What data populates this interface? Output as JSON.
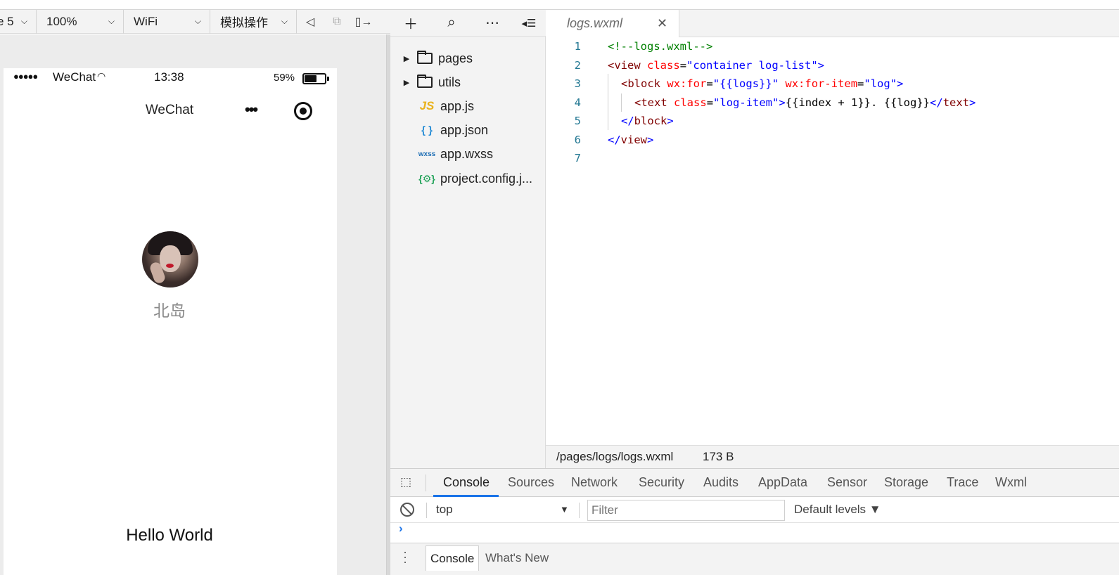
{
  "simulator_toolbar": {
    "device": "e 5",
    "zoom": "100%",
    "network": "WiFi",
    "operation": "模拟操作",
    "icons": [
      "chevron-down-icon",
      "speaker-icon",
      "copy-icon",
      "detach-icon"
    ]
  },
  "phone": {
    "status": {
      "signal": "●●●●●",
      "carrier": "WeChat",
      "time": "13:38",
      "battery": "59%",
      "battery_level": 0.59
    },
    "nav_title": "WeChat",
    "capsule_more": "•••",
    "nickname": "北岛",
    "hello": "Hello World"
  },
  "explorer": {
    "toolbar_icons": [
      "add-icon",
      "search-icon",
      "more-icon",
      "collapse-icon"
    ],
    "items": [
      {
        "type": "folder",
        "label": "pages"
      },
      {
        "type": "folder",
        "label": "utils"
      },
      {
        "type": "file",
        "icon": "JS",
        "label": "app.js"
      },
      {
        "type": "file",
        "icon": "{ }",
        "label": "app.json"
      },
      {
        "type": "file",
        "icon": "wxss",
        "label": "app.wxss"
      },
      {
        "type": "file",
        "icon": "{⚙}",
        "label": "project.config.j..."
      }
    ]
  },
  "editor": {
    "tab": {
      "name": "logs.wxml",
      "close": "✕"
    },
    "line_numbers": [
      "1",
      "2",
      "3",
      "4",
      "5",
      "6",
      "7"
    ],
    "lines": {
      "l1": {
        "comment": "<!--logs.wxml-->"
      },
      "l2": {
        "open": "<",
        "tag": "view",
        "attr1": "class",
        "eq": "=",
        "val1": "\"container log-list\"",
        "close": ">"
      },
      "l3": {
        "open": "<",
        "tag": "block",
        "attr1": "wx:for",
        "val1": "\"{{logs}}\"",
        "attr2": "wx:for-item",
        "val2": "\"log\"",
        "close": ">"
      },
      "l4": {
        "open": "<",
        "tag": "text",
        "attr1": "class",
        "val1": "\"log-item\"",
        "close": ">",
        "content": "{{index + 1}}. {{log}}",
        "end_open": "</",
        "end_tag": "text",
        "end_close": ">"
      },
      "l5": {
        "end_open": "</",
        "end_tag": "block",
        "end_close": ">"
      },
      "l6": {
        "end_open": "</",
        "end_tag": "view",
        "end_close": ">"
      }
    },
    "status_path": "/pages/logs/logs.wxml",
    "status_size": "173 B"
  },
  "devtools": {
    "tabs": [
      "Console",
      "Sources",
      "Network",
      "Security",
      "Audits",
      "AppData",
      "Sensor",
      "Storage",
      "Trace",
      "Wxml"
    ],
    "active_tab": "Console",
    "context": "top",
    "filter_placeholder": "Filter",
    "levels": "Default levels ▼",
    "prompt": "›",
    "drawer_tabs": [
      "Console",
      "What's New"
    ]
  },
  "colors": {
    "accent": "#1a73e8",
    "line_number": "#237893",
    "comment": "#008000",
    "tag": "#800000",
    "attr": "#ff0000",
    "value": "#0000ff"
  }
}
